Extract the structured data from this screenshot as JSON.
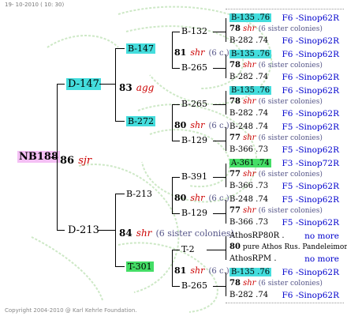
{
  "header": {
    "date": "19- 10-2010 ( 10: 30)"
  },
  "footer": {
    "copyright": "Copyright 2004-2010 @ Karl Kehrle Foundation."
  },
  "colors": {
    "cyan": "#44dddd",
    "green": "#44dd66",
    "pink": "#f4c0f4",
    "red": "#cc0000",
    "blue": "#0000cc",
    "sister": "#555588"
  },
  "root": {
    "code": "NB188",
    "year": "86",
    "mark": "sjr"
  },
  "gen1": [
    {
      "code": "D-147",
      "year": "83",
      "mark": "agg"
    },
    {
      "code": "D-213",
      "year": "84",
      "mark": "shr",
      "note": "(6 sister colonies)"
    }
  ],
  "gen2": [
    {
      "code": "B-147",
      "year": "81",
      "mark": "shr",
      "note": "(6 c.)"
    },
    {
      "code": "B-272",
      "year": "80",
      "mark": "shr",
      "note": "(6 c.)"
    },
    {
      "code": "B-213",
      "year": "80",
      "mark": "shr",
      "note": "(6 c.)"
    },
    {
      "code": "T-301",
      "year": "81",
      "mark": "shr",
      "note": "(6 c.)"
    }
  ],
  "gen3": [
    {
      "code": "B-132"
    },
    {
      "code": "B-265"
    },
    {
      "code": "B-265"
    },
    {
      "code": "B-129"
    },
    {
      "code": "B-391"
    },
    {
      "code": "B-129"
    },
    {
      "code": "T-2"
    },
    {
      "code": "B-265"
    }
  ],
  "gen4": [
    {
      "top": "B-135 .76",
      "top_f": "F6 -Sinop62R",
      "mid_year": "78",
      "mid_mark": "shr",
      "mid_note": "(6 sister colonies)",
      "bot": "B-282 .74",
      "bot_f": "F6 -Sinop62R"
    },
    {
      "top": "B-135 .76",
      "top_f": "F6 -Sinop62R",
      "mid_year": "78",
      "mid_mark": "shr",
      "mid_note": "(6 sister colonies)",
      "bot": "B-282 .74",
      "bot_f": "F6 -Sinop62R"
    },
    {
      "top": "B-135 .76",
      "top_f": "F6 -Sinop62R",
      "mid_year": "78",
      "mid_mark": "shr",
      "mid_note": "(6 sister colonies)",
      "bot": "B-282 .74",
      "bot_f": "F6 -Sinop62R"
    },
    {
      "top": "B-248 .74",
      "top_f": "F5 -Sinop62R",
      "mid_year": "77",
      "mid_mark": "shr",
      "mid_note": "(6 sister colonies)",
      "bot": "B-366 .73",
      "bot_f": "F5 -Sinop62R"
    },
    {
      "top": "A-361 .74",
      "top_f": "F3 -Sinop72R",
      "mid_year": "77",
      "mid_mark": "shr",
      "mid_note": "(6 sister colonies)",
      "bot": "B-366 .73",
      "bot_f": "F5 -Sinop62R"
    },
    {
      "top": "B-248 .74",
      "top_f": "F5 -Sinop62R",
      "mid_year": "77",
      "mid_mark": "shr",
      "mid_note": "(6 sister colonies)",
      "bot": "B-366 .73",
      "bot_f": "F5 -Sinop62R"
    },
    {
      "top": "AthosRP80R .",
      "top_f": "no more",
      "mid_year": "80",
      "mid_text": "pure Athos Rus. Pandeleimonos",
      "bot": "AthosRPM .",
      "bot_f": "no more"
    },
    {
      "top": "B-135 .76",
      "top_f": "F6 -Sinop62R",
      "mid_year": "78",
      "mid_mark": "shr",
      "mid_note": "(6 sister colonies)",
      "bot": "B-282 .74",
      "bot_f": "F6 -Sinop62R"
    }
  ]
}
